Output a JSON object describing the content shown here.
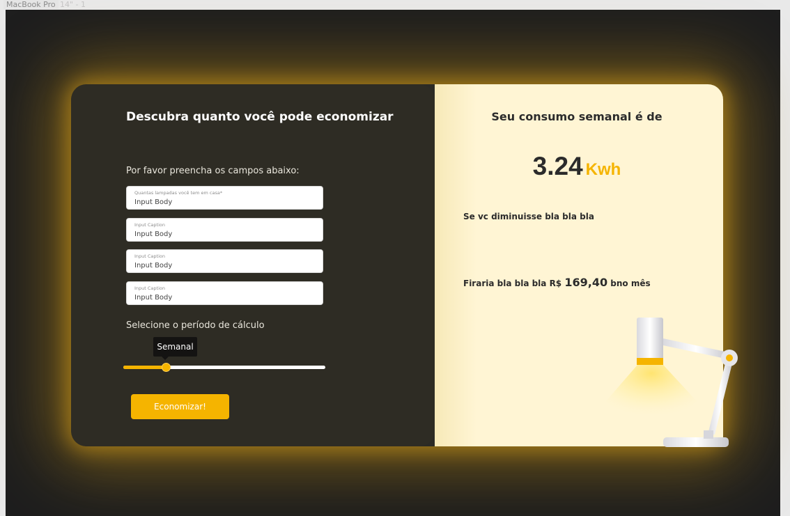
{
  "frame": {
    "label": "MacBook Pro",
    "label_faint": "14\" - 1"
  },
  "form": {
    "title": "Descubra quanto você pode economizar",
    "instructions": "Por favor preencha os campos abaixo:",
    "fields": [
      {
        "caption": "Quantas lampadas você tem em casa*",
        "placeholder": "Input Body"
      },
      {
        "caption": "Input Caption",
        "placeholder": "Input Body"
      },
      {
        "caption": "Input Caption",
        "placeholder": "Input Body"
      },
      {
        "caption": "Input Caption",
        "placeholder": "Input Body"
      }
    ],
    "period_label": "Selecione o período de cálculo",
    "slider": {
      "value_label": "Semanal",
      "fraction": 0.21
    },
    "submit_label": "Economizar!"
  },
  "result": {
    "title": "Seu consumo semanal é de",
    "value": "3.24",
    "unit": "Kwh",
    "tip": "Se vc diminuisse bla bla bla",
    "savings_prefix": "Firaria bla bla bla R$",
    "savings_amount": "169,40",
    "savings_suffix": "bno mês"
  },
  "colors": {
    "accent": "#f5b400",
    "panel_dark": "#2e2c24",
    "panel_light": "#fff5d4",
    "background": "#1e1e1e"
  },
  "icons": {
    "lamp": "desk-lamp-illustration"
  }
}
